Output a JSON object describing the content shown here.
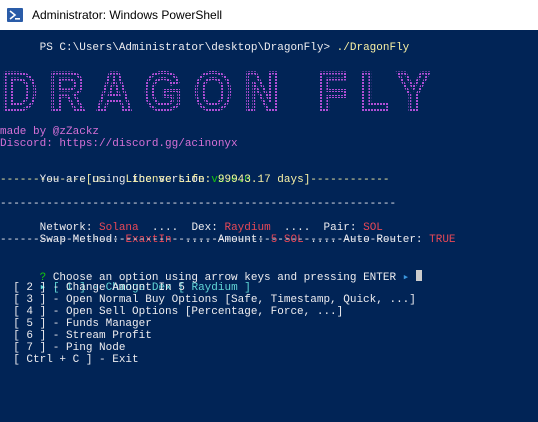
{
  "window": {
    "title": "Administrator: Windows PowerShell"
  },
  "console": {
    "prompt": "PS C:\\Users\\Administrator\\desktop\\DragonFly> ",
    "command": "./DragonFly",
    "banner_text": "DRAGON FLY",
    "made_by": "made by @zZackz",
    "discord": "Discord: https://discord.gg/acinonyx",
    "version_label": "You are using the version ",
    "version_value": "v2.0.0",
    "license_line": "-------------[☐☐   License Life: 99943.17 days]------------",
    "separator": "------------------------------------------------------------",
    "network_label": "Network: ",
    "network_value": "Solana",
    "dex_label": "  ....  Dex: ",
    "dex_value": "Raydium",
    "pair_label": "  ....  Pair: ",
    "pair_value": "SOL",
    "swap_label": "Swap Method: ",
    "swap_value": "ExaxtIn",
    "amount_label": "  .... Amount: ",
    "amount_value": "5 SOL",
    "router_label": " .... Auto Router: ",
    "router_value": "TRUE",
    "question_mark": "? ",
    "question": "Choose an option using arrow keys and pressing ENTER",
    "question_arrow": " ▸ ",
    "selected_marker": "▸",
    "menu": [
      "[ 1 ] - Change Dex [ Raydium ]",
      "[ 2 ] - Change Amount In 5",
      "[ 3 ] - Open Normal Buy Options [Safe, Timestamp, Quick, ...]",
      "[ 4 ] - Open Sell Options [Percentage, Force, ...]",
      "[ 5 ] - Funds Manager",
      "[ 6 ] - Stream Profit",
      "[ 7 ] - Ping Node",
      "[ Ctrl + C ] - Exit"
    ],
    "colors": {
      "background": "#012456",
      "banner": "#b14fd6",
      "highlight": "#61d6d6"
    }
  }
}
